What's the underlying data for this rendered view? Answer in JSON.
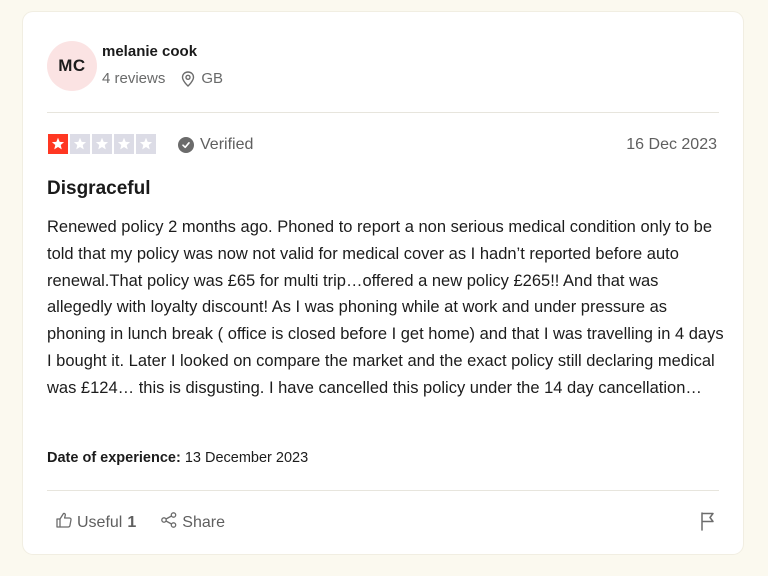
{
  "reviewer": {
    "initials": "MC",
    "name": "melanie cook",
    "reviews": "4 reviews",
    "country": "GB"
  },
  "review": {
    "rating": 1,
    "verified_label": "Verified",
    "date": "16 Dec 2023",
    "title": "Disgraceful",
    "text": "Renewed policy 2 months ago. Phoned to report a non serious medical condition only to be told that my policy was now not valid for medical cover as I hadn’t reported before auto renewal.That policy was £65 for multi trip…offered a new policy £265!! And that was allegedly with loyalty discount! As I was phoning while at work and under pressure as phoning in lunch break ( office is closed before I get home) and that I was travelling in 4 days I bought it. Later I looked on compare the market and the exact policy still declaring medical was £124… this is disgusting. I have cancelled this policy under the 14 day cancellation…",
    "experience_label": "Date of experience:",
    "experience_date": "13 December 2023"
  },
  "actions": {
    "useful_label": "Useful",
    "useful_count": "1",
    "share_label": "Share"
  },
  "icons": {
    "location": "map-pin-icon",
    "verified": "check-circle-icon",
    "useful": "thumbs-up-icon",
    "share": "share-icon",
    "report": "flag-icon"
  },
  "colors": {
    "star_filled": "#ff3722",
    "star_empty": "#dcdce6",
    "avatar_bg": "#fbe3e3",
    "page_bg": "#fbf9ef"
  }
}
